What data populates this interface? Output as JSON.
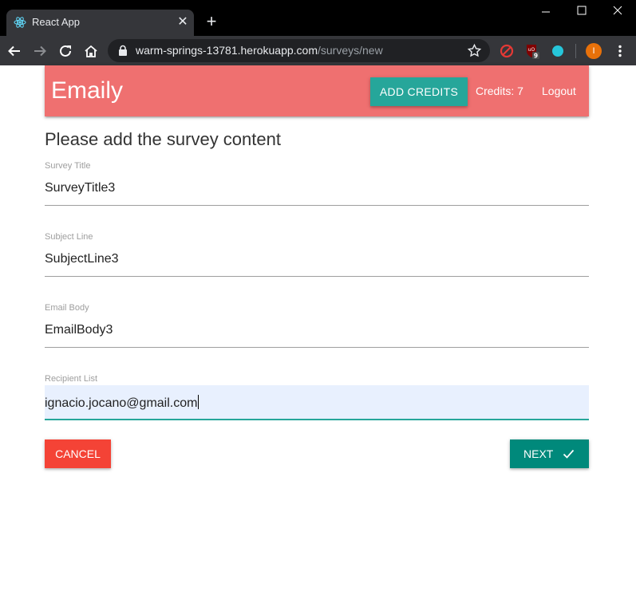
{
  "browser": {
    "tab_title": "React App",
    "tab_close": "✕",
    "new_tab": "+",
    "url_host": "warm-springs-13781.herokuapp.com",
    "url_path": "/surveys/new",
    "profile_initial": "I",
    "ublock_count": "9",
    "colors": {
      "titlebar": "#000000",
      "toolbar": "#35363a",
      "omnibox": "#202124"
    }
  },
  "header": {
    "brand": "Emaily",
    "add_credits_label": "ADD CREDITS",
    "credits_label": "Credits: 7",
    "logout_label": "Logout",
    "colors": {
      "nav": "#ef7070",
      "accent": "#26a69a"
    }
  },
  "form": {
    "heading": "Please add the survey content",
    "fields": [
      {
        "label": "Survey Title",
        "value": "SurveyTitle3"
      },
      {
        "label": "Subject Line",
        "value": "SubjectLine3"
      },
      {
        "label": "Email Body",
        "value": "EmailBody3"
      },
      {
        "label": "Recipient List",
        "value": "ignacio.jocano@gmail.com"
      }
    ],
    "cancel_label": "CANCEL",
    "next_label": "NEXT",
    "colors": {
      "cancel": "#f44336",
      "next": "#00897b"
    }
  }
}
